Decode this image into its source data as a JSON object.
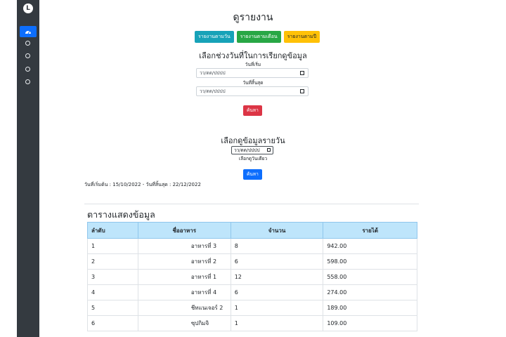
{
  "sidebar": {
    "logo_text": "L",
    "icons": [
      "dashboard-icon",
      "circle-icon",
      "circle-icon",
      "circle-icon",
      "circle-icon"
    ]
  },
  "page": {
    "title": "ดูรายงาน",
    "buttons": {
      "daily": "รายงานตามวัน",
      "monthly": "รายงานตามเดือน",
      "yearly": "รายงานตามปี"
    },
    "range_section": {
      "heading": "เลือกช่วงวันที่ในการเรียกดูข้อมูล",
      "start_label": "วันที่เริ่ม",
      "start_placeholder": "วว/ดด/ปปปป",
      "end_label": "วันที่สิ้นสุด",
      "end_placeholder": "วว/ดด/ปปปป",
      "search_button": "ค้นหา"
    },
    "daily_section": {
      "heading": "เลือกดูข้อมูลรายวัน",
      "date_placeholder": "วว/ดด/ปปปป",
      "hint": "เลือกดูวันเดียว",
      "search_button": "ค้นหา"
    },
    "date_range_text": "วันที่เริ่มต้น : 15/10/2022 - วันที่สิ้นสุด : 22/12/2022"
  },
  "table": {
    "title": "ตารางแสดงข้อมูล",
    "headers": [
      "ลำดับ",
      "ชื่ออาหาร",
      "จำนวน",
      "รายได้"
    ],
    "rows": [
      [
        "1",
        "อาหารที่ 3",
        "8",
        "942.00"
      ],
      [
        "2",
        "อาหารที่ 2",
        "6",
        "598.00"
      ],
      [
        "3",
        "อาหารที่ 1",
        "12",
        "558.00"
      ],
      [
        "4",
        "อาหารที่ 4",
        "6",
        "274.00"
      ],
      [
        "5",
        "ชีทแนเจอร์ 2",
        "1",
        "189.00"
      ],
      [
        "6",
        "ซุปกิมจิ",
        "1",
        "109.00"
      ]
    ]
  },
  "colors": {
    "sidebar": "#343a40",
    "active": "#0d6efd",
    "info": "#17a2b8",
    "success": "#28a745",
    "warning": "#ffc107",
    "danger": "#dc3545",
    "table_header": "#bee5fb"
  }
}
